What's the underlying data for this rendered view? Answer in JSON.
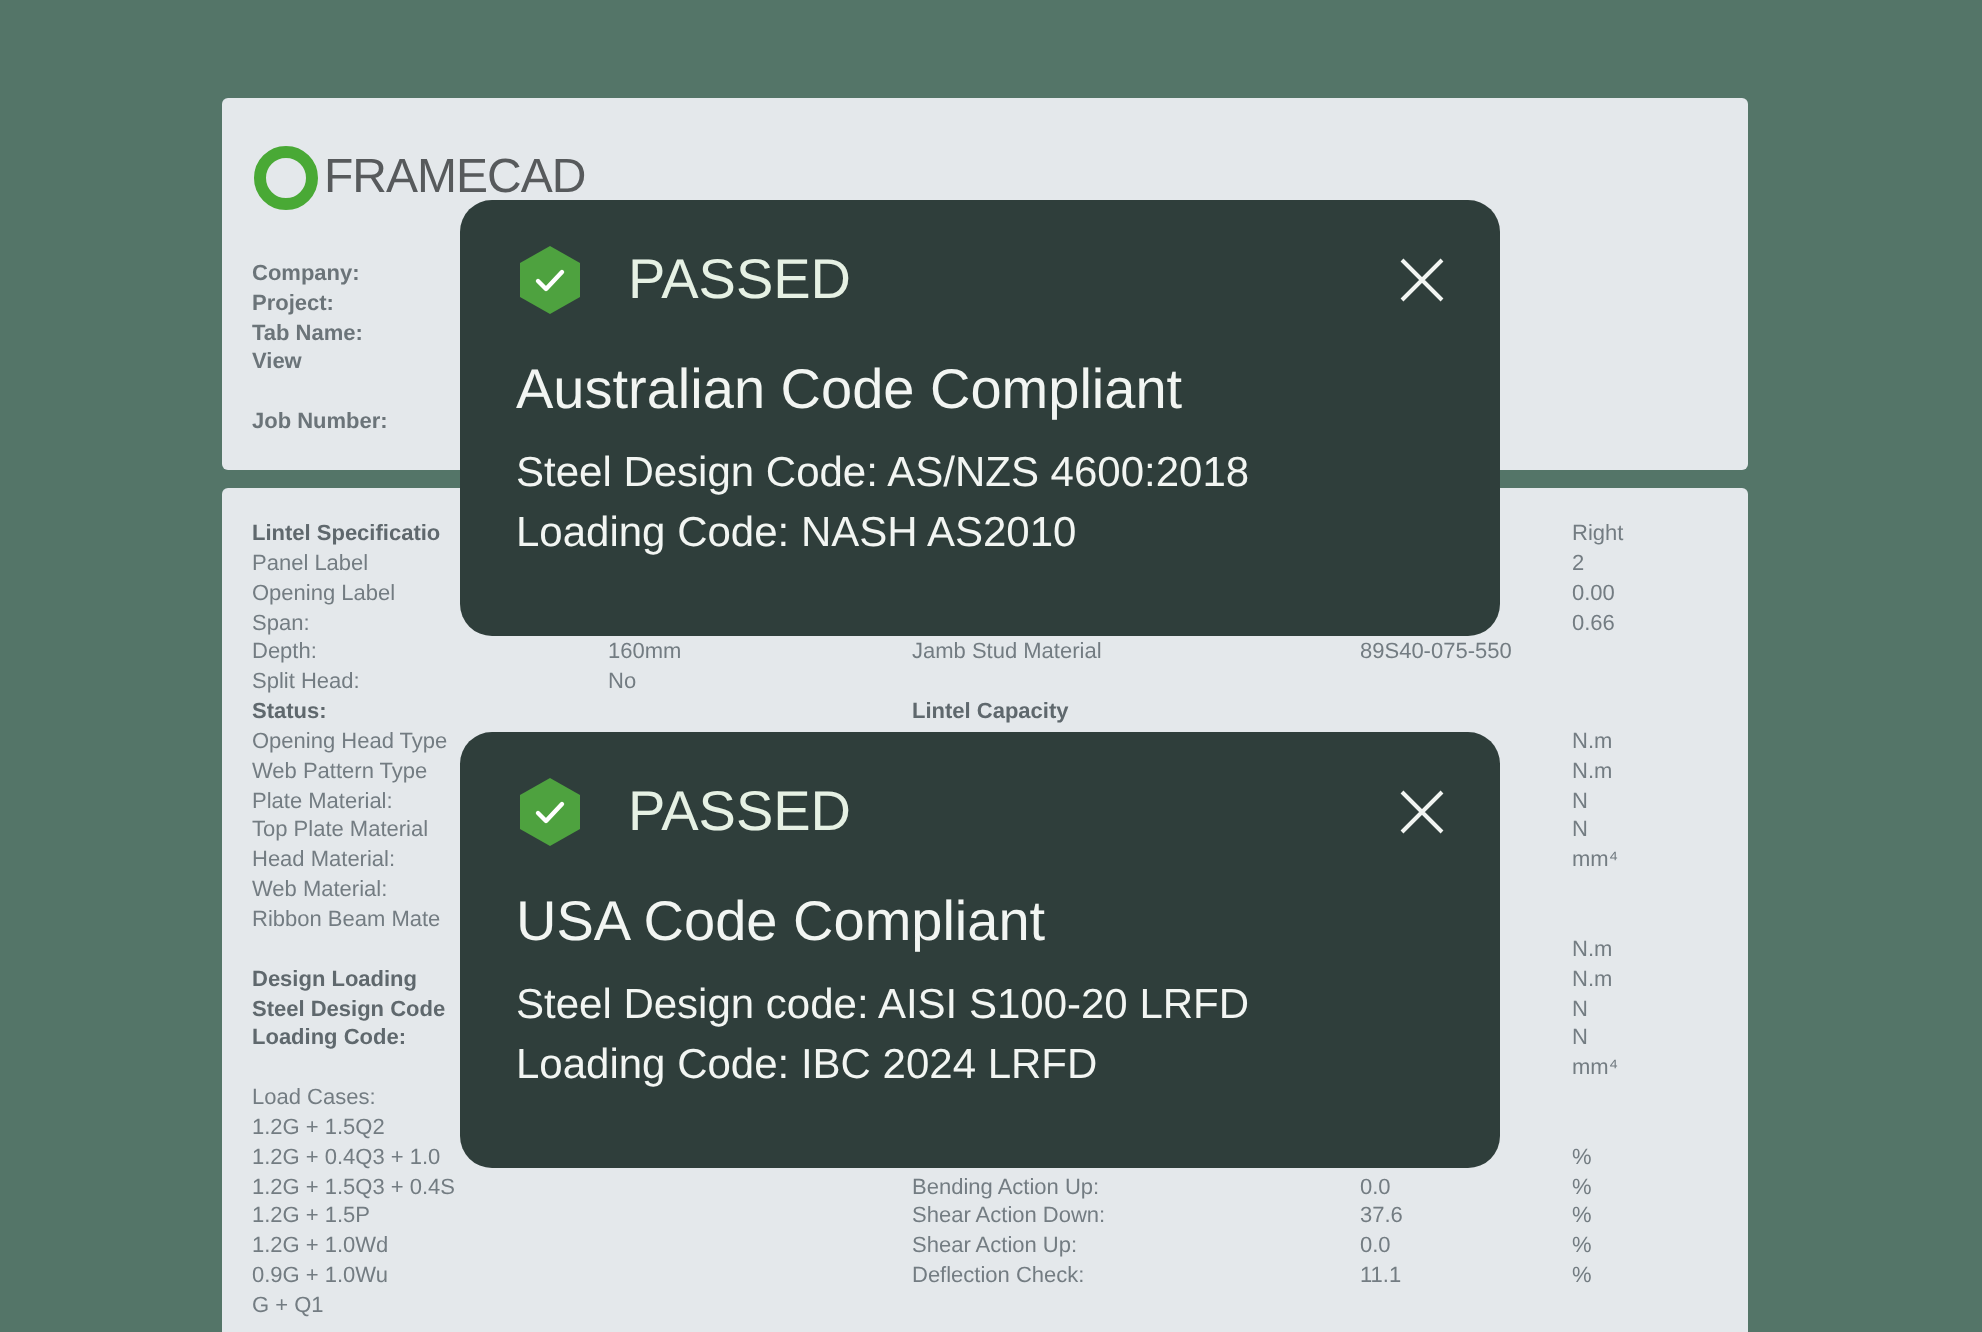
{
  "report_header": {
    "logo_text": "FRAMECAD",
    "fields": [
      "Company:",
      "Project:",
      "Tab Name:",
      "View"
    ],
    "job_field": "Job Number:"
  },
  "report_rows": [
    {
      "label": "Lintel Specificatio",
      "label_bold": true,
      "unit": "Right"
    },
    {
      "label": "Panel Label",
      "label_bold": false,
      "unit": "2"
    },
    {
      "label": "Opening Label",
      "label_bold": false,
      "unit": "0.00"
    },
    {
      "label": "Span:",
      "label_bold": false,
      "unit": "0.66"
    },
    {
      "label": "Depth:",
      "label_bold": false,
      "value": "160mm",
      "label_2": "Jamb Stud Material",
      "label_2_bold": false,
      "value_2": "89S40-075-550"
    },
    {
      "label": "Split Head:",
      "label_bold": false,
      "value": "No"
    },
    {
      "label": "Status:",
      "label_bold": true,
      "label_2": "Lintel Capacity",
      "label_2_bold": true
    },
    {
      "label": "Opening Head Type",
      "label_bold": false,
      "unit": "N.m"
    },
    {
      "label": "Web Pattern Type",
      "label_bold": false,
      "unit": "N.m"
    },
    {
      "label": "Plate Material:",
      "label_bold": false,
      "unit": "N"
    },
    {
      "label": "Top Plate Material",
      "label_bold": false,
      "unit": "N"
    },
    {
      "label": "Head Material:",
      "label_bold": false,
      "unit": "mm⁴"
    },
    {
      "label": "Web Material:",
      "label_bold": false
    },
    {
      "label": "Ribbon Beam Mate",
      "label_bold": false
    },
    {
      "unit": "N.m"
    },
    {
      "label": "Design Loading",
      "label_bold": true,
      "unit": "N.m"
    },
    {
      "label": "Steel Design Code",
      "label_bold": true,
      "unit": "N"
    },
    {
      "label": "Loading Code:",
      "label_bold": true,
      "unit": "N"
    },
    {
      "unit": "mm⁴"
    },
    {
      "label": "Load Cases:",
      "label_bold": false
    },
    {
      "label": "1.2G + 1.5Q2",
      "label_bold": false
    },
    {
      "label": "1.2G + 0.4Q3 + 1.0",
      "label_bold": false,
      "unit": "%"
    },
    {
      "label": "1.2G + 1.5Q3 + 0.4S",
      "label_bold": false,
      "label_2": "Bending Action Up:",
      "label_2_bold": false,
      "value_2": "0.0",
      "unit": "%"
    },
    {
      "label": "1.2G + 1.5P",
      "label_bold": false,
      "label_2": "Shear Action Down:",
      "label_2_bold": false,
      "value_2": "37.6",
      "unit": "%"
    },
    {
      "label": "1.2G + 1.0Wd",
      "label_bold": false,
      "label_2": "Shear Action Up:",
      "label_2_bold": false,
      "value_2": "0.0",
      "unit": "%"
    },
    {
      "label": "0.9G + 1.0Wu",
      "label_bold": false,
      "label_2": "Deflection Check:",
      "label_2_bold": false,
      "value_2": "11.1",
      "unit": "%"
    },
    {
      "label": "G + Q1",
      "label_bold": false
    }
  ],
  "notifications": [
    {
      "status": "PASSED",
      "kind": "passed",
      "title": "Australian Code Compliant",
      "lines": [
        "Steel Design Code: AS/NZS 4600:2018",
        "Loading Code: NASH AS2010"
      ]
    },
    {
      "status": "PASSED",
      "kind": "passed",
      "title": "USA Code Compliant",
      "lines": [
        "Steel Design code: AISI S100-20 LRFD",
        "Loading Code: IBC 2024 LRFD"
      ]
    }
  ]
}
